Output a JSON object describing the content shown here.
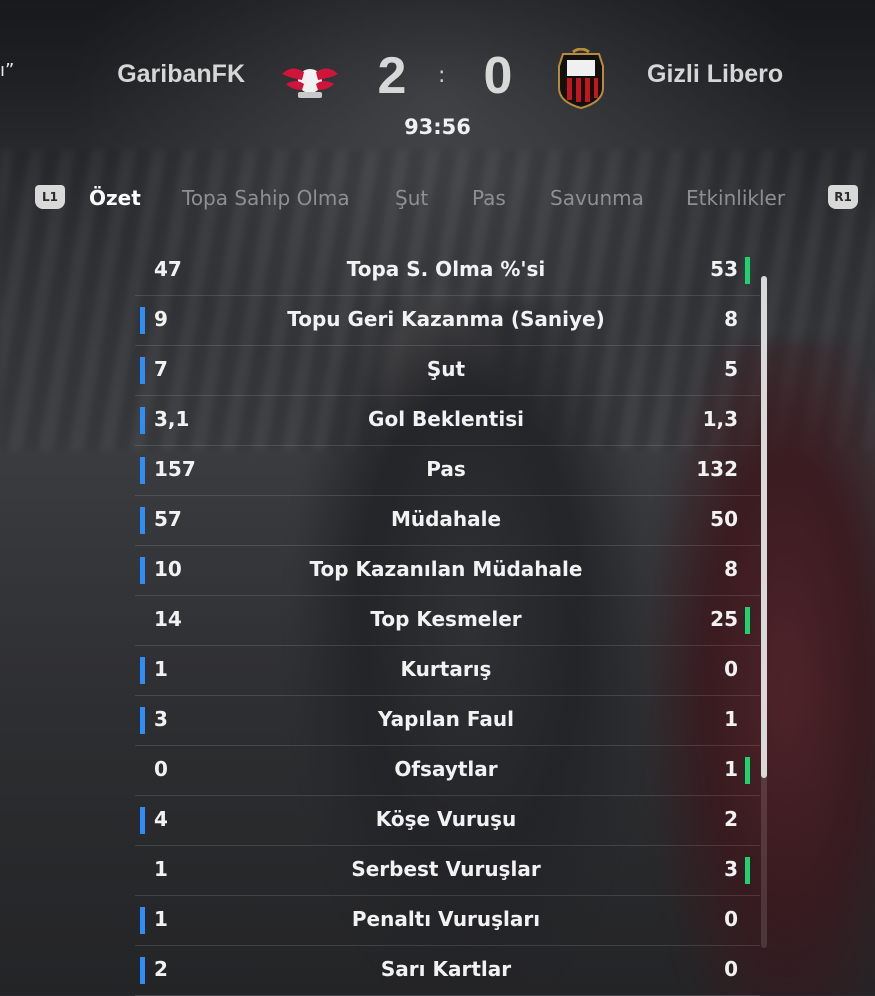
{
  "header": {
    "partial_left_text": "ı”",
    "home_team": "GaribanFK",
    "away_team": "Gizli Libero",
    "home_score": "2",
    "separator": ":",
    "away_score": "0",
    "clock": "93:56",
    "home_crest": "rb-leipzig-crest",
    "away_crest": "ogc-nice-crest"
  },
  "tabs": {
    "left_button": "L1",
    "right_button": "R1",
    "items": [
      {
        "label": "Özet",
        "active": true
      },
      {
        "label": "Topa Sahip Olma",
        "active": false
      },
      {
        "label": "Şut",
        "active": false
      },
      {
        "label": "Pas",
        "active": false
      },
      {
        "label": "Savunma",
        "active": false
      },
      {
        "label": "Etkinlikler",
        "active": false
      }
    ]
  },
  "stats": [
    {
      "label": "Topa S. Olma %'si",
      "home": "47",
      "away": "53",
      "leader": "away"
    },
    {
      "label": "Topu Geri Kazanma (Saniye)",
      "home": "9",
      "away": "8",
      "leader": "home"
    },
    {
      "label": "Şut",
      "home": "7",
      "away": "5",
      "leader": "home"
    },
    {
      "label": "Gol Beklentisi",
      "home": "3,1",
      "away": "1,3",
      "leader": "home"
    },
    {
      "label": "Pas",
      "home": "157",
      "away": "132",
      "leader": "home"
    },
    {
      "label": "Müdahale",
      "home": "57",
      "away": "50",
      "leader": "home"
    },
    {
      "label": "Top Kazanılan Müdahale",
      "home": "10",
      "away": "8",
      "leader": "home"
    },
    {
      "label": "Top Kesmeler",
      "home": "14",
      "away": "25",
      "leader": "away"
    },
    {
      "label": "Kurtarış",
      "home": "1",
      "away": "0",
      "leader": "home"
    },
    {
      "label": "Yapılan Faul",
      "home": "3",
      "away": "1",
      "leader": "home"
    },
    {
      "label": "Ofsaytlar",
      "home": "0",
      "away": "1",
      "leader": "away"
    },
    {
      "label": "Köşe Vuruşu",
      "home": "4",
      "away": "2",
      "leader": "home"
    },
    {
      "label": "Serbest Vuruşlar",
      "home": "1",
      "away": "3",
      "leader": "away"
    },
    {
      "label": "Penaltı Vuruşları",
      "home": "1",
      "away": "0",
      "leader": "home"
    },
    {
      "label": "Sarı Kartlar",
      "home": "2",
      "away": "0",
      "leader": "home"
    }
  ],
  "colors": {
    "home_lead_bar": "#2f8df5",
    "away_lead_bar": "#1fd16f"
  }
}
